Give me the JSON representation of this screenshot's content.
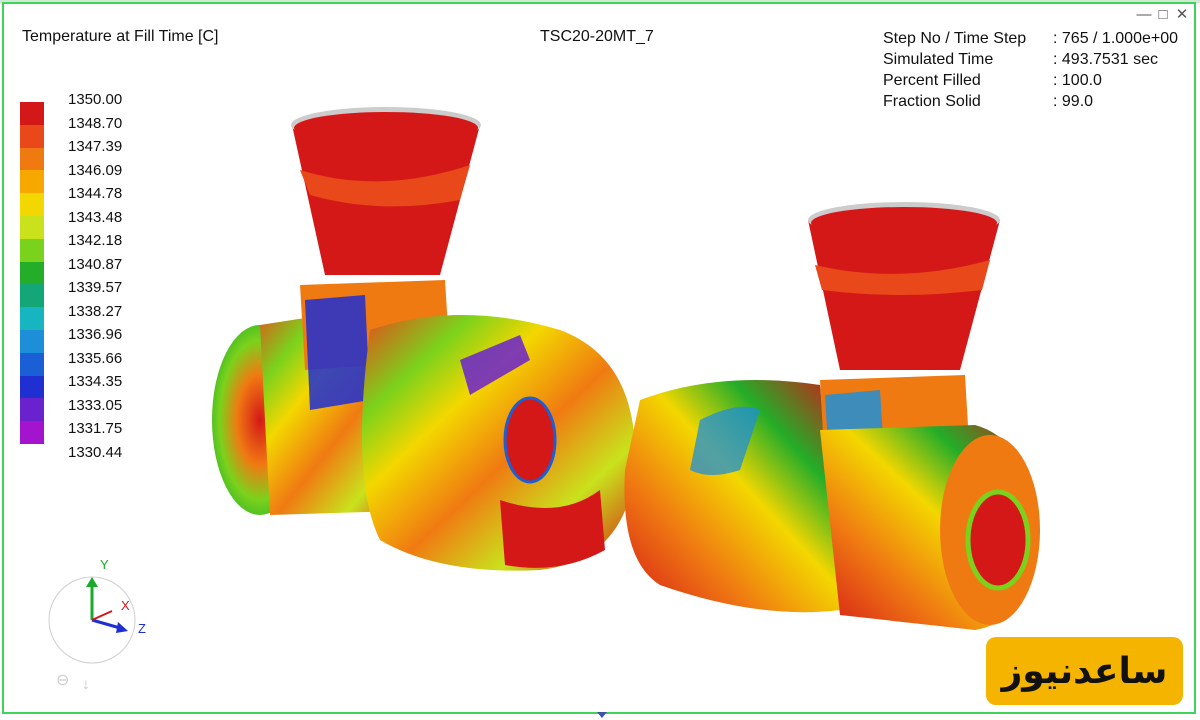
{
  "viewer": {
    "result_title": "Temperature at Fill Time [C]",
    "model_name": "TSC20-20MT_7",
    "info": [
      {
        "key": "Step No / Time Step",
        "value": ": 765 / 1.000e+00"
      },
      {
        "key": "Simulated Time",
        "value": ": 493.7531 sec"
      },
      {
        "key": "Percent Filled",
        "value": ": 100.0"
      },
      {
        "key": "Fraction Solid",
        "value": ": 99.0"
      }
    ],
    "window_controls": [
      "minimize-icon",
      "restore-icon",
      "close-icon"
    ]
  },
  "legend": {
    "ticks": [
      "1350.00",
      "1348.70",
      "1347.39",
      "1346.09",
      "1344.78",
      "1343.48",
      "1342.18",
      "1340.87",
      "1339.57",
      "1338.27",
      "1336.96",
      "1335.66",
      "1334.35",
      "1333.05",
      "1331.75",
      "1330.44"
    ],
    "colors": [
      "#d41818",
      "#e8481a",
      "#f07a12",
      "#f7a800",
      "#f3d700",
      "#c9e21c",
      "#7bd21c",
      "#23ad28",
      "#14a676",
      "#16b5bf",
      "#1d8fd8",
      "#1a5fd6",
      "#1f2fd2",
      "#6a22cf",
      "#a414cf"
    ]
  },
  "triad": {
    "y_label": "Y",
    "x_label": "X",
    "z_label": "Z"
  },
  "logo": {
    "text": "ساعدنیوز",
    "color": "#f5b400"
  }
}
